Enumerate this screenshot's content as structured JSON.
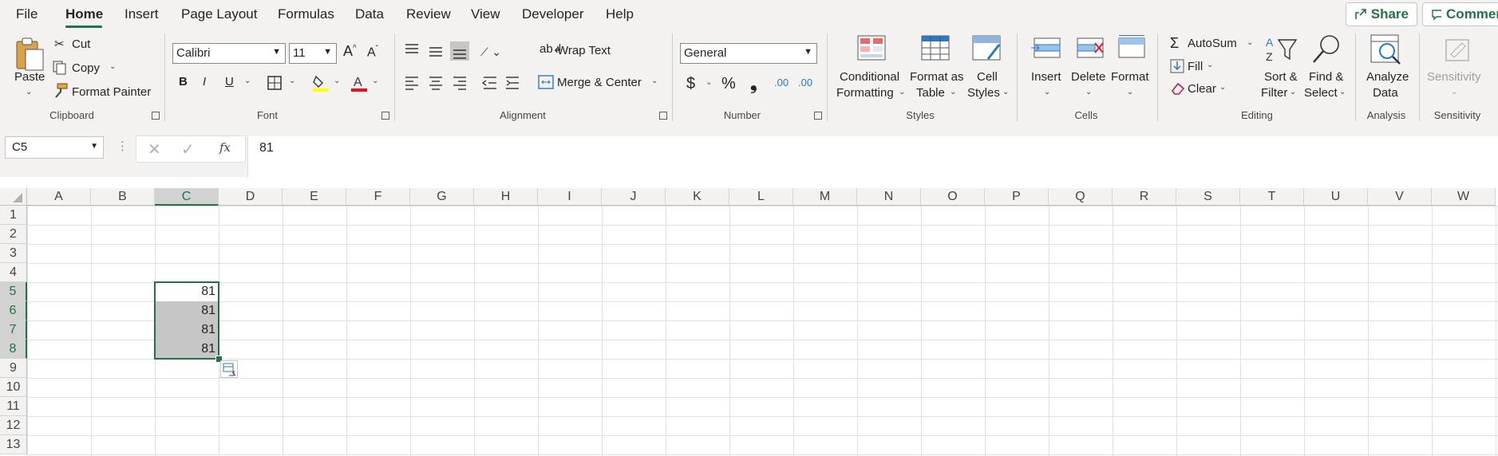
{
  "menu": {
    "tabs": [
      "File",
      "Home",
      "Insert",
      "Page Layout",
      "Formulas",
      "Data",
      "Review",
      "View",
      "Developer",
      "Help"
    ],
    "active": "Home",
    "share_label": "Share",
    "comments_label": "Commer"
  },
  "ribbon": {
    "clipboard": {
      "paste": "Paste",
      "cut": "Cut",
      "copy": "Copy",
      "format_painter": "Format Painter",
      "label": "Clipboard"
    },
    "font": {
      "name": "Calibri",
      "size": "11",
      "bold": "B",
      "italic": "I",
      "underline": "U",
      "label": "Font"
    },
    "alignment": {
      "wrap_text": "Wrap Text",
      "merge_center": "Merge & Center",
      "label": "Alignment"
    },
    "number": {
      "format": "General",
      "currency": "$",
      "percent": "%",
      "comma": "❟",
      "inc_dec": ".00",
      "dec_dec": ".00",
      "label": "Number"
    },
    "styles": {
      "conditional_1": "Conditional",
      "conditional_2": "Formatting",
      "table_1": "Format as",
      "table_2": "Table",
      "cell_1": "Cell",
      "cell_2": "Styles",
      "label": "Styles"
    },
    "cells": {
      "insert": "Insert",
      "delete": "Delete",
      "format": "Format",
      "label": "Cells"
    },
    "editing": {
      "autosum": "AutoSum",
      "fill": "Fill",
      "clear": "Clear",
      "sort_1": "Sort &",
      "sort_2": "Filter",
      "find_1": "Find &",
      "find_2": "Select",
      "label": "Editing"
    },
    "analysis": {
      "analyze_1": "Analyze",
      "analyze_2": "Data",
      "label": "Analysis"
    },
    "sensitivity": {
      "button": "Sensitivity",
      "label": "Sensitivity"
    }
  },
  "formula_bar": {
    "name_box": "C5",
    "fx": "fx",
    "value": "81"
  },
  "sheet": {
    "columns": [
      "A",
      "B",
      "C",
      "D",
      "E",
      "F",
      "G",
      "H",
      "I",
      "J",
      "K",
      "L",
      "M",
      "N",
      "O",
      "P",
      "Q",
      "R",
      "S",
      "T",
      "U",
      "V",
      "W"
    ],
    "rows": [
      "1",
      "2",
      "3",
      "4",
      "5",
      "6",
      "7",
      "8",
      "9",
      "10",
      "11",
      "12",
      "13"
    ],
    "selected_column": "C",
    "selected_rows": [
      "5",
      "6",
      "7",
      "8"
    ],
    "cells": [
      {
        "ref": "C5",
        "value": "81"
      },
      {
        "ref": "C6",
        "value": "81"
      },
      {
        "ref": "C7",
        "value": "81"
      },
      {
        "ref": "C8",
        "value": "81"
      }
    ]
  },
  "colors": {
    "accent": "#217346",
    "font_red": "#e81123",
    "highlight_yellow": "#ffff00"
  }
}
